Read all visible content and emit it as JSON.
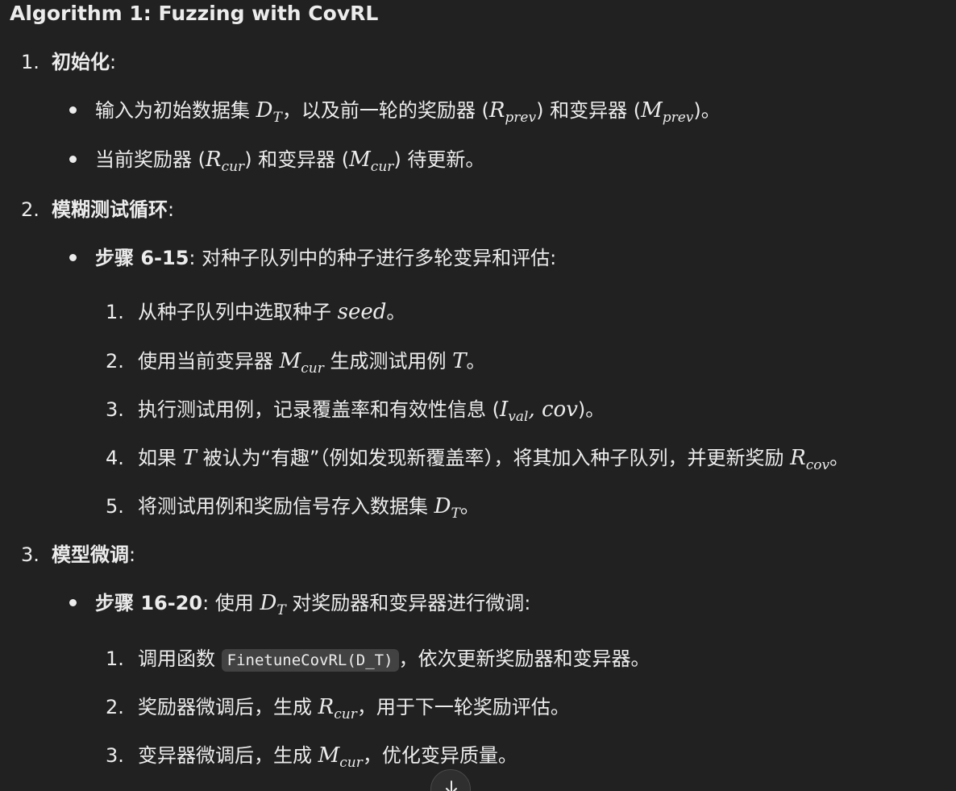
{
  "title": "Algorithm 1: Fuzzing with CovRL",
  "s1": {
    "num": "1.",
    "head": "初始化",
    "colon": ":",
    "b1": {
      "t1": "输入为初始数据集 ",
      "D": "D",
      "D_sub": "T",
      "t2": "，以及前一轮的奖励器 (",
      "R": "R",
      "R_sub": "prev",
      "t3": ") 和变异器 (",
      "M": "M",
      "M_sub": "prev",
      "t4": ")。"
    },
    "b2": {
      "t1": "当前奖励器 (",
      "R": "R",
      "R_sub": "cur",
      "t2": ") 和变异器 (",
      "M": "M",
      "M_sub": "cur",
      "t3": ") 待更新。"
    }
  },
  "s2": {
    "num": "2.",
    "head": "模糊测试循环",
    "colon": ":",
    "bullet": {
      "bold": "步骤 6-15",
      "text": ": 对种子队列中的种子进行多轮变异和评估:"
    },
    "items": {
      "i1": {
        "num": "1.",
        "t1": "从种子队列中选取种子 ",
        "seed": "seed",
        "t2": "。"
      },
      "i2": {
        "num": "2.",
        "t1": "使用当前变异器 ",
        "M": "M",
        "M_sub": "cur",
        "t2": " 生成测试用例 ",
        "T": "T",
        "t3": "。"
      },
      "i3": {
        "num": "3.",
        "t1": "执行测试用例，记录覆盖率和有效性信息 (",
        "I": "I",
        "I_sub": "val",
        "comma": ", ",
        "cov": "cov",
        "t2": ")。"
      },
      "i4": {
        "num": "4.",
        "t1": "如果 ",
        "T": "T",
        "t2": " 被认为“有趣”（例如发现新覆盖率），将其加入种子队列，并更新奖励 ",
        "R": "R",
        "R_sub": "cov",
        "t3": "。"
      },
      "i5": {
        "num": "5.",
        "t1": "将测试用例和奖励信号存入数据集 ",
        "D": "D",
        "D_sub": "T",
        "t2": "。"
      }
    }
  },
  "s3": {
    "num": "3.",
    "head": "模型微调",
    "colon": ":",
    "bullet": {
      "bold": "步骤 16-20",
      "t1": ": 使用 ",
      "D": "D",
      "D_sub": "T",
      "t2": " 对奖励器和变异器进行微调:"
    },
    "items": {
      "i1": {
        "num": "1.",
        "t1": "调用函数 ",
        "code": "FinetuneCovRL(D_T)",
        "t2": "，依次更新奖励器和变异器。"
      },
      "i2": {
        "num": "2.",
        "t1": "奖励器微调后，生成 ",
        "R": "R",
        "R_sub": "cur",
        "t2": "，用于下一轮奖励评估。"
      },
      "i3": {
        "num": "3.",
        "t1": "变异器微调后，生成 ",
        "M": "M",
        "M_sub": "cur",
        "t2": "，优化变异质量。"
      }
    }
  },
  "icons": {
    "scroll": "arrow-down-icon"
  }
}
